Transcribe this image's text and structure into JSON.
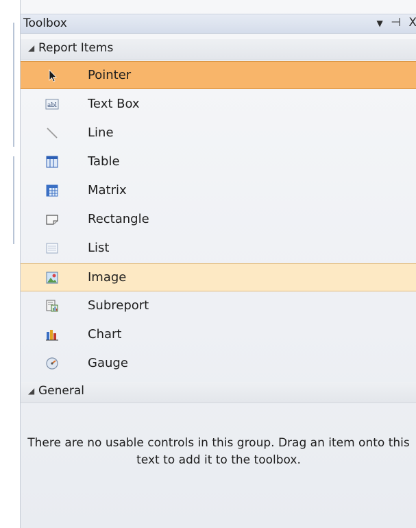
{
  "toolbox": {
    "title": "Toolbox",
    "controls": {
      "dropdown": "▼",
      "pin": "⊣",
      "close": "X"
    }
  },
  "groups": [
    {
      "label": "Report Items",
      "items": [
        {
          "label": "Pointer",
          "icon": "pointer-icon",
          "state": "selected"
        },
        {
          "label": "Text Box",
          "icon": "text-box-icon",
          "state": ""
        },
        {
          "label": "Line",
          "icon": "line-icon",
          "state": ""
        },
        {
          "label": "Table",
          "icon": "table-icon",
          "state": ""
        },
        {
          "label": "Matrix",
          "icon": "matrix-icon",
          "state": ""
        },
        {
          "label": "Rectangle",
          "icon": "rectangle-icon",
          "state": ""
        },
        {
          "label": "List",
          "icon": "list-icon",
          "state": ""
        },
        {
          "label": "Image",
          "icon": "image-icon",
          "state": "hover"
        },
        {
          "label": "Subreport",
          "icon": "subreport-icon",
          "state": ""
        },
        {
          "label": "Chart",
          "icon": "chart-icon",
          "state": ""
        },
        {
          "label": "Gauge",
          "icon": "gauge-icon",
          "state": ""
        }
      ]
    },
    {
      "label": "General",
      "empty_message": "There are no usable controls in this group. Drag an item onto this text to add it to the toolbox."
    }
  ],
  "colors": {
    "selected": "#f8b56a",
    "hover": "#fde9c4"
  }
}
